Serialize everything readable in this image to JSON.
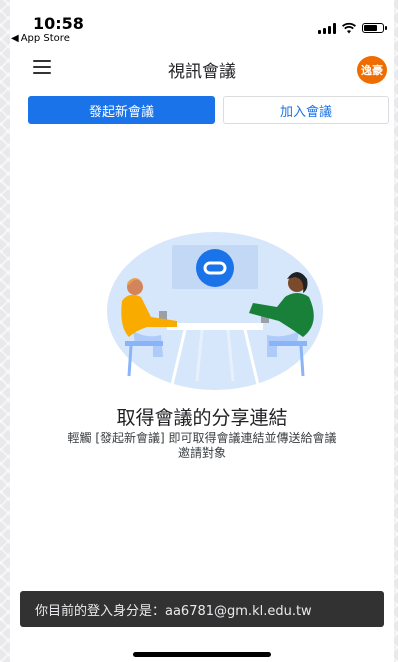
{
  "status_bar": {
    "time": "10:58",
    "back_label": "App Store"
  },
  "app_bar": {
    "title": "視訊會議",
    "avatar_text": "逸豪"
  },
  "actions": {
    "new_meeting": "發起新會議",
    "join_meeting": "加入會議"
  },
  "empty_state": {
    "title": "取得會議的分享連結",
    "description_line1": "輕觸 [發起新會議] 即可取得會議連結並傳送給會議",
    "description_line2": "邀請對象"
  },
  "snackbar": {
    "message": "你目前的登入身分是：aa6781@gm.kl.edu.tw"
  },
  "colors": {
    "primary": "#1a73e8",
    "avatar": "#ef6c00",
    "snackbar": "#323232"
  }
}
